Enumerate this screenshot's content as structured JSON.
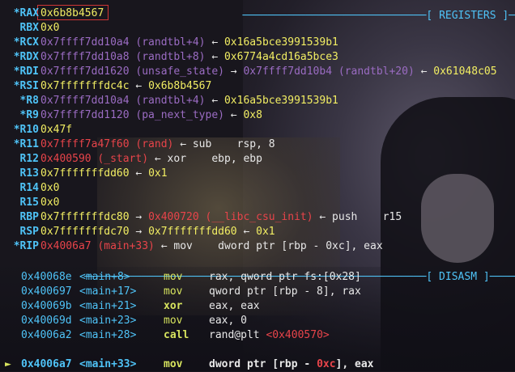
{
  "sections": {
    "registers_header": "[ REGISTERS ]",
    "disasm_header": "[ DISASM ]"
  },
  "registers": [
    {
      "name": "RAX",
      "changed": true,
      "parts": [
        {
          "t": "0x6b8b4567",
          "c": "yellow"
        }
      ]
    },
    {
      "name": "RBX",
      "changed": false,
      "parts": [
        {
          "t": "0x0",
          "c": "yellow"
        }
      ]
    },
    {
      "name": "RCX",
      "changed": true,
      "parts": [
        {
          "t": "0x7ffff7dd10a4 (randtbl+4)",
          "c": "purple"
        },
        {
          "t": " ← ",
          "c": "arrow"
        },
        {
          "t": "0x16a5bce3991539b1",
          "c": "yellow"
        }
      ]
    },
    {
      "name": "RDX",
      "changed": true,
      "parts": [
        {
          "t": "0x7ffff7dd10a8 (randtbl+8)",
          "c": "purple"
        },
        {
          "t": " ← ",
          "c": "arrow"
        },
        {
          "t": "0x6774a4cd16a5bce3",
          "c": "yellow"
        }
      ]
    },
    {
      "name": "RDI",
      "changed": true,
      "parts": [
        {
          "t": "0x7ffff7dd1620 (unsafe_state)",
          "c": "purple"
        },
        {
          "t": " → ",
          "c": "arrow"
        },
        {
          "t": "0x7ffff7dd10b4 (randtbl+20)",
          "c": "purple"
        },
        {
          "t": " ← ",
          "c": "arrow"
        },
        {
          "t": "0x61048c05",
          "c": "yellow"
        }
      ]
    },
    {
      "name": "RSI",
      "changed": true,
      "parts": [
        {
          "t": "0x7fffffffdc4c",
          "c": "yellow"
        },
        {
          "t": " ← ",
          "c": "arrow"
        },
        {
          "t": "0x6b8b4567",
          "c": "yellow"
        }
      ]
    },
    {
      "name": "R8",
      "changed": true,
      "parts": [
        {
          "t": "0x7ffff7dd10a4 (randtbl+4)",
          "c": "purple"
        },
        {
          "t": " ← ",
          "c": "arrow"
        },
        {
          "t": "0x16a5bce3991539b1",
          "c": "yellow"
        }
      ]
    },
    {
      "name": "R9",
      "changed": true,
      "parts": [
        {
          "t": "0x7ffff7dd1120 (pa_next_type)",
          "c": "purple"
        },
        {
          "t": " ← ",
          "c": "arrow"
        },
        {
          "t": "0x8",
          "c": "yellow"
        }
      ]
    },
    {
      "name": "R10",
      "changed": true,
      "parts": [
        {
          "t": "0x47f",
          "c": "yellow"
        }
      ]
    },
    {
      "name": "R11",
      "changed": true,
      "parts": [
        {
          "t": "0x7ffff7a47f60 (rand)",
          "c": "red"
        },
        {
          "t": " ← ",
          "c": "arrow"
        },
        {
          "t": "sub    rsp, 8",
          "c": "white"
        }
      ]
    },
    {
      "name": "R12",
      "changed": false,
      "parts": [
        {
          "t": "0x400590 (_start)",
          "c": "red"
        },
        {
          "t": " ← ",
          "c": "arrow"
        },
        {
          "t": "xor    ebp, ebp",
          "c": "white"
        }
      ]
    },
    {
      "name": "R13",
      "changed": false,
      "parts": [
        {
          "t": "0x7fffffffdd60",
          "c": "yellow"
        },
        {
          "t": " ← ",
          "c": "arrow"
        },
        {
          "t": "0x1",
          "c": "yellow"
        }
      ]
    },
    {
      "name": "R14",
      "changed": false,
      "parts": [
        {
          "t": "0x0",
          "c": "yellow"
        }
      ]
    },
    {
      "name": "R15",
      "changed": false,
      "parts": [
        {
          "t": "0x0",
          "c": "yellow"
        }
      ]
    },
    {
      "name": "RBP",
      "changed": false,
      "parts": [
        {
          "t": "0x7fffffffdc80",
          "c": "yellow"
        },
        {
          "t": " → ",
          "c": "arrow"
        },
        {
          "t": "0x400720 (__libc_csu_init)",
          "c": "red"
        },
        {
          "t": " ← ",
          "c": "arrow"
        },
        {
          "t": "push    r15",
          "c": "white"
        }
      ]
    },
    {
      "name": "RSP",
      "changed": false,
      "parts": [
        {
          "t": "0x7fffffffdc70",
          "c": "yellow"
        },
        {
          "t": " → ",
          "c": "arrow"
        },
        {
          "t": "0x7fffffffdd60",
          "c": "yellow"
        },
        {
          "t": " ← ",
          "c": "arrow"
        },
        {
          "t": "0x1",
          "c": "yellow"
        }
      ]
    },
    {
      "name": "RIP",
      "changed": true,
      "parts": [
        {
          "t": "0x4006a7 (main+33)",
          "c": "red"
        },
        {
          "t": " ← ",
          "c": "arrow"
        },
        {
          "t": "mov    dword ptr [rbp - 0xc], eax",
          "c": "white"
        }
      ]
    }
  ],
  "disasm": [
    {
      "addr": "0x40068e",
      "sym": "<main+8>",
      "op": "mov",
      "args": "rax, qword ptr fs:[0x28]",
      "current": false
    },
    {
      "addr": "0x400697",
      "sym": "<main+17>",
      "op": "mov",
      "args": "qword ptr [rbp - 8], rax",
      "current": false
    },
    {
      "addr": "0x40069b",
      "sym": "<main+21>",
      "op": "xor",
      "args": "eax, eax",
      "current": false
    },
    {
      "addr": "0x40069d",
      "sym": "<main+23>",
      "op": "mov",
      "args": "eax, 0",
      "current": false
    },
    {
      "addr": "0x4006a2",
      "sym": "<main+28>",
      "op": "call",
      "args": "rand@plt ",
      "args_extra": "<0x400570>",
      "current": false
    },
    {
      "addr": "0x4006a7",
      "sym": "<main+33>",
      "op": "mov",
      "args": "dword ptr [rbp - ",
      "args_hex": "0xc",
      "args_tail": "], eax",
      "current": true,
      "pointer": "►"
    }
  ],
  "colors": {
    "register_name": "#4fc3f7",
    "value": "#f2ee63",
    "code_symbol": "#e8444a",
    "data_symbol": "#9b6cc3",
    "opcode": "#d7e45e",
    "highlight_box": "#d03535"
  }
}
